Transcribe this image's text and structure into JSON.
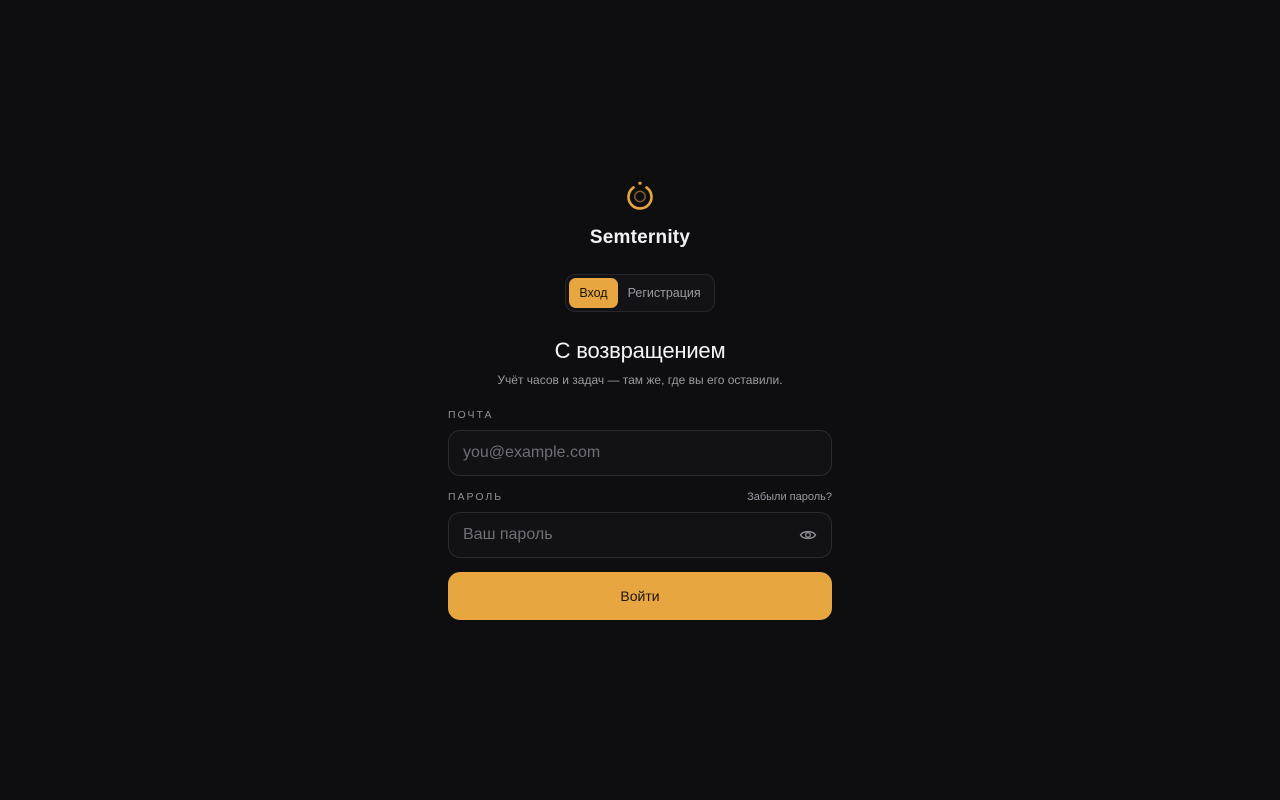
{
  "brand": {
    "name": "Semternity",
    "logo_icon": "power-ring-icon",
    "accent_color": "#e8a640"
  },
  "tabs": [
    {
      "label": "Вход",
      "active": true
    },
    {
      "label": "Регистрация",
      "active": false
    }
  ],
  "form": {
    "heading": "С возвращением",
    "subheading": "Учёт часов и задач — там же, где вы его оставили.",
    "email": {
      "label": "ПОЧТА",
      "value": "",
      "placeholder": "you@example.com"
    },
    "password": {
      "label": "ПАРОЛЬ",
      "value": "",
      "placeholder": "Ваш пароль",
      "forgot_link": "Забыли пароль?",
      "toggle_icon": "eye-icon"
    },
    "submit_label": "Войти"
  }
}
